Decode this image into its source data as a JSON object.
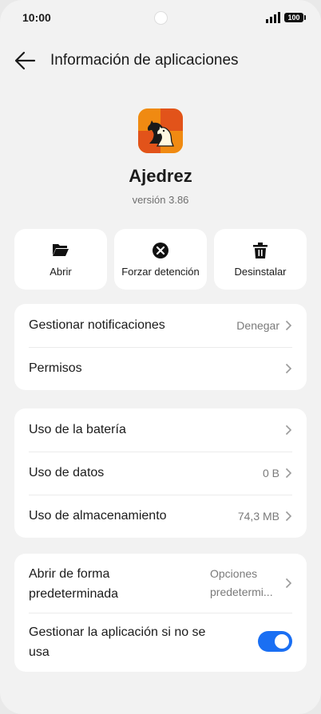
{
  "status_bar": {
    "time": "10:00",
    "battery": "100"
  },
  "header": {
    "title": "Información de aplicaciones"
  },
  "app": {
    "name": "Ajedrez",
    "version": "versión 3.86"
  },
  "actions": [
    {
      "label": "Abrir",
      "icon": "folder-open-icon"
    },
    {
      "label": "Forzar detención",
      "icon": "close-circle-icon"
    },
    {
      "label": "Desinstalar",
      "icon": "trash-icon"
    }
  ],
  "notifications_card": {
    "manage_notifications": {
      "label": "Gestionar notificaciones",
      "value": "Denegar"
    },
    "permissions": {
      "label": "Permisos"
    }
  },
  "usage_card": {
    "battery": {
      "label": "Uso de la batería"
    },
    "data": {
      "label": "Uso de datos",
      "value": "0 B"
    },
    "storage": {
      "label": "Uso de almacenamiento",
      "value": "74,3 MB"
    }
  },
  "defaults_card": {
    "open_default": {
      "label_line1": "Abrir de forma",
      "label_line2": "predeterminada",
      "value_line1": "Opciones",
      "value_line2": "predetermi..."
    },
    "manage_unused": {
      "label_line1": "Gestionar la aplicación si no se",
      "label_line2": "usa",
      "enabled": true
    }
  },
  "colors": {
    "accent": "#1a6ff3",
    "background": "#f2f2f2",
    "card": "#ffffff"
  }
}
